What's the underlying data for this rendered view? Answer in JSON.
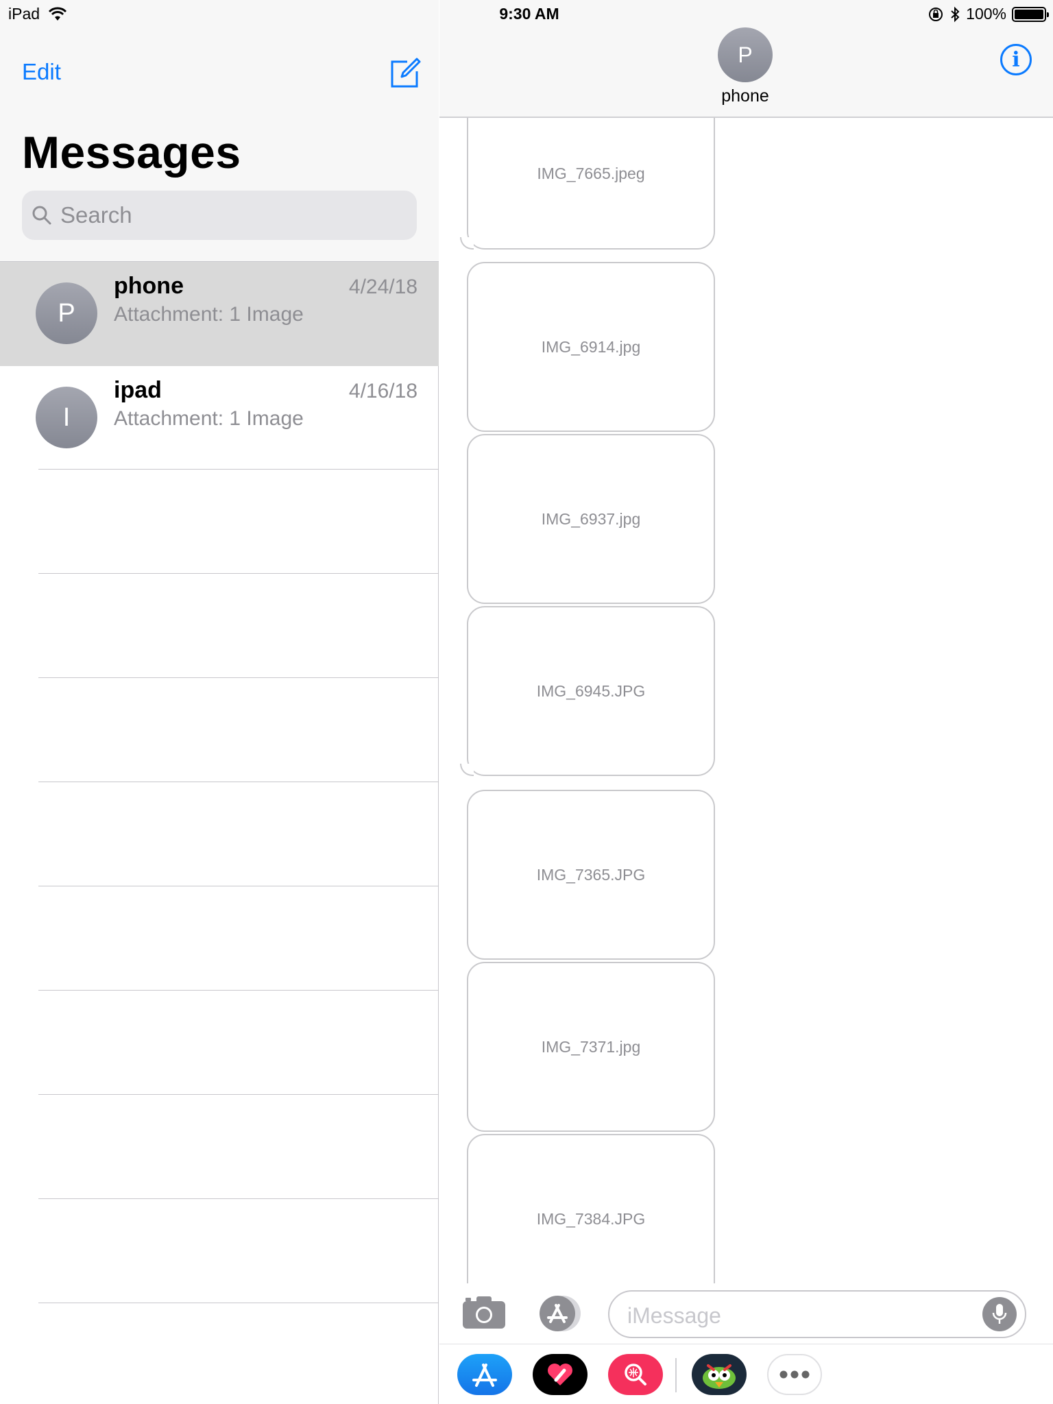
{
  "status_bar": {
    "device": "iPad",
    "time": "9:30 AM",
    "battery": "100%"
  },
  "sidebar": {
    "edit_label": "Edit",
    "title": "Messages",
    "search_placeholder": "Search",
    "conversations": [
      {
        "initial": "P",
        "name": "phone",
        "date": "4/24/18",
        "preview": "Attachment: 1 Image",
        "selected": true
      },
      {
        "initial": "I",
        "name": "ipad",
        "date": "4/16/18",
        "preview": "Attachment: 1 Image",
        "selected": false
      }
    ]
  },
  "conversation": {
    "contact_initial": "P",
    "contact_name": "phone",
    "attachments": [
      "IMG_7665.jpeg",
      "IMG_6914.jpg",
      "IMG_6937.jpg",
      "IMG_6945.JPG",
      "IMG_7365.JPG",
      "IMG_7371.jpg",
      "IMG_7384.JPG"
    ],
    "input_placeholder": "iMessage"
  },
  "icons": [
    "wifi-icon",
    "orientation-lock-icon",
    "bluetooth-icon",
    "battery-icon",
    "compose-icon",
    "search-icon",
    "info-icon",
    "camera-icon",
    "app-store-icon",
    "microphone-icon",
    "more-icon"
  ],
  "colors": {
    "accent": "#0a7aff",
    "selected_row": "#d9d9d9"
  }
}
